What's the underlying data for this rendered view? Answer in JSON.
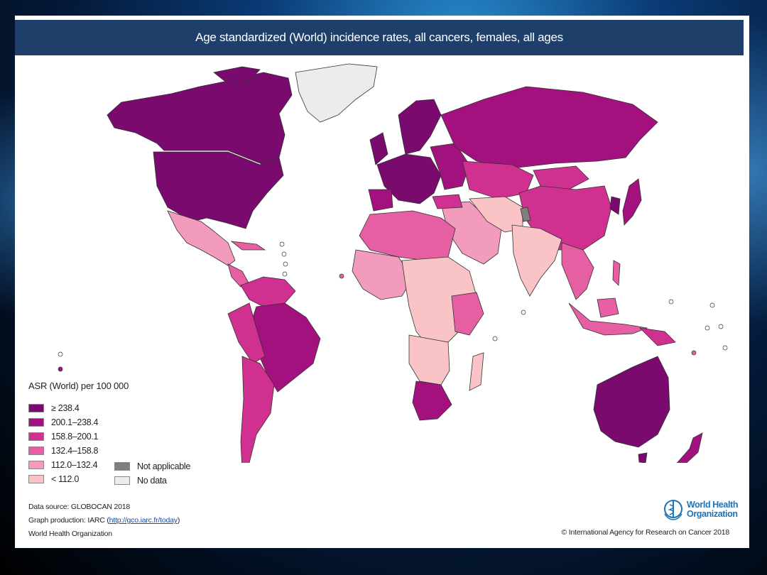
{
  "title": "Age standardized (World) incidence rates, all cancers, females, all ages",
  "legend": {
    "title": "ASR (World) per 100 000",
    "classes": [
      {
        "label": "≥ 238.4",
        "color": "#7a0a6e"
      },
      {
        "label": "200.1–238.4",
        "color": "#a3117e"
      },
      {
        "label": "158.8–200.1",
        "color": "#d0308f"
      },
      {
        "label": "132.4–158.8",
        "color": "#e65fa2"
      },
      {
        "label": "112.0–132.4",
        "color": "#f29bbd"
      },
      {
        "label": "< 112.0",
        "color": "#fac4c6"
      }
    ],
    "extra": [
      {
        "label": "Not applicable",
        "color": "#7f7f7f"
      },
      {
        "label": "No data",
        "color": "#ececec"
      }
    ]
  },
  "footer": {
    "source": "Data source: GLOBOCAN 2018",
    "production_prefix": "Graph production: IARC (",
    "production_link": "http://gco.iarc.fr/today",
    "production_suffix": ")",
    "org": "World Health Organization",
    "copyright": "© International Agency for Research on Cancer 2018"
  },
  "logo": {
    "line1": "World Health",
    "line2": "Organization"
  },
  "colors": {
    "title_bar": "#1f3f6b",
    "ocean": "#ffffff"
  }
}
